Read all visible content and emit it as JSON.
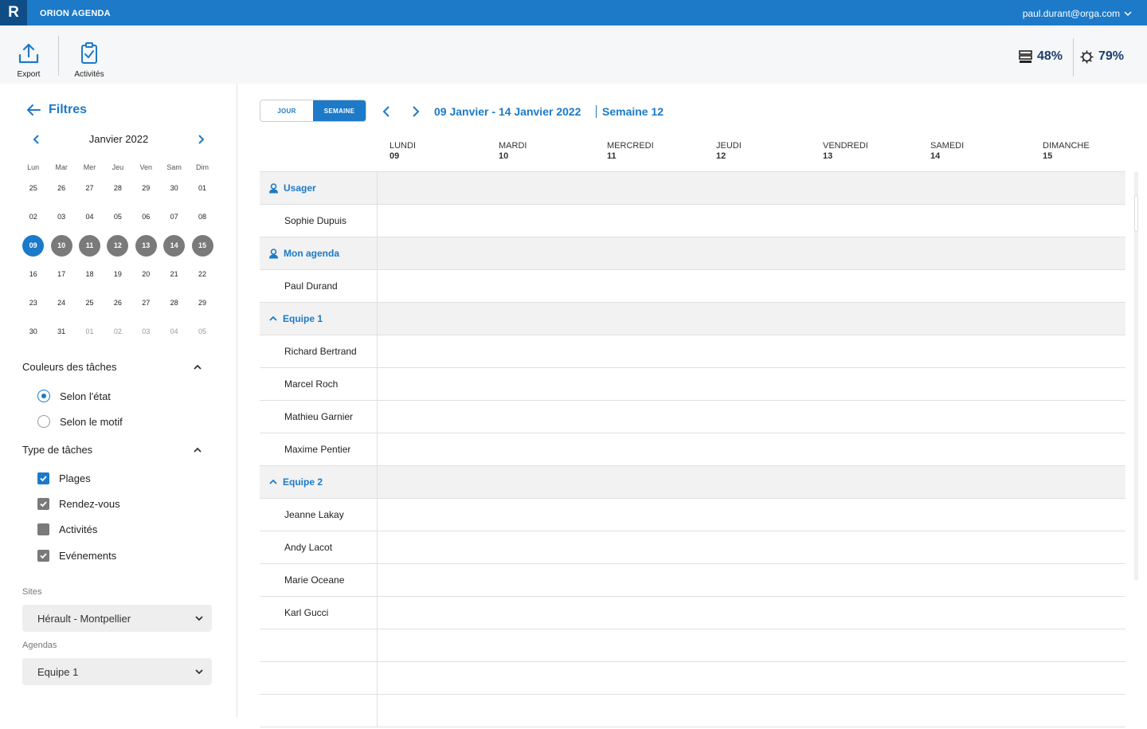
{
  "topbar": {
    "app_name": "ORION AGENDA",
    "logo_letter": "R",
    "user_email": "paul.durant@orga.com"
  },
  "toolbar": {
    "export_label": "Export",
    "activites_label": "Activités",
    "stat_storage": "48%",
    "stat_cpu": "79%"
  },
  "filters": {
    "title": "Filtres",
    "month": "Janvier 2022",
    "weekdays": [
      "Lun",
      "Mar",
      "Mer",
      "Jeu",
      "Ven",
      "Sam",
      "Dim"
    ],
    "weeks": [
      [
        {
          "d": "25"
        },
        {
          "d": "26"
        },
        {
          "d": "27"
        },
        {
          "d": "28"
        },
        {
          "d": "29"
        },
        {
          "d": "30"
        },
        {
          "d": "01"
        }
      ],
      [
        {
          "d": "02"
        },
        {
          "d": "03"
        },
        {
          "d": "04"
        },
        {
          "d": "05"
        },
        {
          "d": "06"
        },
        {
          "d": "07"
        },
        {
          "d": "08"
        }
      ],
      [
        {
          "d": "09",
          "sel": true
        },
        {
          "d": "10",
          "week": true
        },
        {
          "d": "11",
          "week": true
        },
        {
          "d": "12",
          "week": true
        },
        {
          "d": "13",
          "week": true
        },
        {
          "d": "14",
          "week": true
        },
        {
          "d": "15",
          "week": true
        }
      ],
      [
        {
          "d": "16"
        },
        {
          "d": "17"
        },
        {
          "d": "18"
        },
        {
          "d": "19"
        },
        {
          "d": "20"
        },
        {
          "d": "21"
        },
        {
          "d": "22"
        }
      ],
      [
        {
          "d": "23"
        },
        {
          "d": "24"
        },
        {
          "d": "25"
        },
        {
          "d": "26"
        },
        {
          "d": "27"
        },
        {
          "d": "28"
        },
        {
          "d": "29"
        }
      ],
      [
        {
          "d": "30"
        },
        {
          "d": "31"
        },
        {
          "d": "01",
          "muted": true
        },
        {
          "d": "02",
          "muted": true
        },
        {
          "d": "03",
          "muted": true
        },
        {
          "d": "04",
          "muted": true
        },
        {
          "d": "05",
          "muted": true
        }
      ]
    ],
    "colors_section": "Couleurs des tâches",
    "color_option_state": "Selon l'état",
    "color_option_motif": "Selon le motif",
    "type_section": "Type de tâches",
    "type_plages": "Plages",
    "type_rdv": "Rendez-vous",
    "type_activites": "Activités",
    "type_evenements": "Evénements",
    "sites_label": "Sites",
    "sites_value": "Hérault - Montpellier",
    "agendas_label": "Agendas",
    "agendas_value": "Equipe 1"
  },
  "main": {
    "toggle_day": "JOUR",
    "toggle_week": "SEMAINE",
    "date_range": "09 Janvier - 14 Janvier 2022",
    "week_label": "Semaine 12",
    "days": [
      {
        "name": "LUNDI",
        "num": "09"
      },
      {
        "name": "MARDI",
        "num": "10"
      },
      {
        "name": "MERCREDI",
        "num": "11"
      },
      {
        "name": "JEUDI",
        "num": "12"
      },
      {
        "name": "VENDREDI",
        "num": "13"
      },
      {
        "name": "SAMEDI",
        "num": "14"
      },
      {
        "name": "DIMANCHE",
        "num": "15"
      }
    ],
    "rows": [
      {
        "type": "group",
        "icon": "user",
        "label": "Usager"
      },
      {
        "type": "person",
        "label": "Sophie Dupuis"
      },
      {
        "type": "group",
        "icon": "user",
        "label": "Mon agenda"
      },
      {
        "type": "person",
        "label": "Paul Durand"
      },
      {
        "type": "group",
        "icon": "chevron",
        "label": "Equipe 1"
      },
      {
        "type": "person",
        "label": "Richard Bertrand"
      },
      {
        "type": "person",
        "label": "Marcel Roch"
      },
      {
        "type": "person",
        "label": "Mathieu Garnier"
      },
      {
        "type": "person",
        "label": "Maxime Pentier"
      },
      {
        "type": "group",
        "icon": "chevron",
        "label": "Equipe 2"
      },
      {
        "type": "person",
        "label": "Jeanne Lakay"
      },
      {
        "type": "person",
        "label": "Andy Lacot"
      },
      {
        "type": "person",
        "label": "Marie Oceane"
      },
      {
        "type": "person",
        "label": "Karl Gucci"
      },
      {
        "type": "empty",
        "label": ""
      },
      {
        "type": "empty",
        "label": ""
      },
      {
        "type": "empty",
        "label": ""
      }
    ]
  }
}
